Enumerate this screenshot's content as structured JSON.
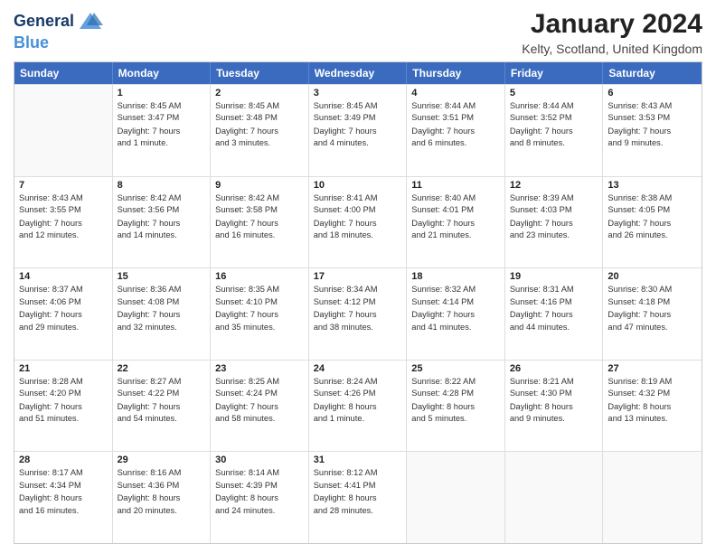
{
  "header": {
    "logo_line1": "General",
    "logo_line2": "Blue",
    "title": "January 2024",
    "subtitle": "Kelty, Scotland, United Kingdom"
  },
  "days_of_week": [
    "Sunday",
    "Monday",
    "Tuesday",
    "Wednesday",
    "Thursday",
    "Friday",
    "Saturday"
  ],
  "weeks": [
    [
      {
        "day": "",
        "sunrise": "",
        "sunset": "",
        "daylight": ""
      },
      {
        "day": "1",
        "sunrise": "Sunrise: 8:45 AM",
        "sunset": "Sunset: 3:47 PM",
        "daylight": "Daylight: 7 hours and 1 minute."
      },
      {
        "day": "2",
        "sunrise": "Sunrise: 8:45 AM",
        "sunset": "Sunset: 3:48 PM",
        "daylight": "Daylight: 7 hours and 3 minutes."
      },
      {
        "day": "3",
        "sunrise": "Sunrise: 8:45 AM",
        "sunset": "Sunset: 3:49 PM",
        "daylight": "Daylight: 7 hours and 4 minutes."
      },
      {
        "day": "4",
        "sunrise": "Sunrise: 8:44 AM",
        "sunset": "Sunset: 3:51 PM",
        "daylight": "Daylight: 7 hours and 6 minutes."
      },
      {
        "day": "5",
        "sunrise": "Sunrise: 8:44 AM",
        "sunset": "Sunset: 3:52 PM",
        "daylight": "Daylight: 7 hours and 8 minutes."
      },
      {
        "day": "6",
        "sunrise": "Sunrise: 8:43 AM",
        "sunset": "Sunset: 3:53 PM",
        "daylight": "Daylight: 7 hours and 9 minutes."
      }
    ],
    [
      {
        "day": "7",
        "sunrise": "Sunrise: 8:43 AM",
        "sunset": "Sunset: 3:55 PM",
        "daylight": "Daylight: 7 hours and 12 minutes."
      },
      {
        "day": "8",
        "sunrise": "Sunrise: 8:42 AM",
        "sunset": "Sunset: 3:56 PM",
        "daylight": "Daylight: 7 hours and 14 minutes."
      },
      {
        "day": "9",
        "sunrise": "Sunrise: 8:42 AM",
        "sunset": "Sunset: 3:58 PM",
        "daylight": "Daylight: 7 hours and 16 minutes."
      },
      {
        "day": "10",
        "sunrise": "Sunrise: 8:41 AM",
        "sunset": "Sunset: 4:00 PM",
        "daylight": "Daylight: 7 hours and 18 minutes."
      },
      {
        "day": "11",
        "sunrise": "Sunrise: 8:40 AM",
        "sunset": "Sunset: 4:01 PM",
        "daylight": "Daylight: 7 hours and 21 minutes."
      },
      {
        "day": "12",
        "sunrise": "Sunrise: 8:39 AM",
        "sunset": "Sunset: 4:03 PM",
        "daylight": "Daylight: 7 hours and 23 minutes."
      },
      {
        "day": "13",
        "sunrise": "Sunrise: 8:38 AM",
        "sunset": "Sunset: 4:05 PM",
        "daylight": "Daylight: 7 hours and 26 minutes."
      }
    ],
    [
      {
        "day": "14",
        "sunrise": "Sunrise: 8:37 AM",
        "sunset": "Sunset: 4:06 PM",
        "daylight": "Daylight: 7 hours and 29 minutes."
      },
      {
        "day": "15",
        "sunrise": "Sunrise: 8:36 AM",
        "sunset": "Sunset: 4:08 PM",
        "daylight": "Daylight: 7 hours and 32 minutes."
      },
      {
        "day": "16",
        "sunrise": "Sunrise: 8:35 AM",
        "sunset": "Sunset: 4:10 PM",
        "daylight": "Daylight: 7 hours and 35 minutes."
      },
      {
        "day": "17",
        "sunrise": "Sunrise: 8:34 AM",
        "sunset": "Sunset: 4:12 PM",
        "daylight": "Daylight: 7 hours and 38 minutes."
      },
      {
        "day": "18",
        "sunrise": "Sunrise: 8:32 AM",
        "sunset": "Sunset: 4:14 PM",
        "daylight": "Daylight: 7 hours and 41 minutes."
      },
      {
        "day": "19",
        "sunrise": "Sunrise: 8:31 AM",
        "sunset": "Sunset: 4:16 PM",
        "daylight": "Daylight: 7 hours and 44 minutes."
      },
      {
        "day": "20",
        "sunrise": "Sunrise: 8:30 AM",
        "sunset": "Sunset: 4:18 PM",
        "daylight": "Daylight: 7 hours and 47 minutes."
      }
    ],
    [
      {
        "day": "21",
        "sunrise": "Sunrise: 8:28 AM",
        "sunset": "Sunset: 4:20 PM",
        "daylight": "Daylight: 7 hours and 51 minutes."
      },
      {
        "day": "22",
        "sunrise": "Sunrise: 8:27 AM",
        "sunset": "Sunset: 4:22 PM",
        "daylight": "Daylight: 7 hours and 54 minutes."
      },
      {
        "day": "23",
        "sunrise": "Sunrise: 8:25 AM",
        "sunset": "Sunset: 4:24 PM",
        "daylight": "Daylight: 7 hours and 58 minutes."
      },
      {
        "day": "24",
        "sunrise": "Sunrise: 8:24 AM",
        "sunset": "Sunset: 4:26 PM",
        "daylight": "Daylight: 8 hours and 1 minute."
      },
      {
        "day": "25",
        "sunrise": "Sunrise: 8:22 AM",
        "sunset": "Sunset: 4:28 PM",
        "daylight": "Daylight: 8 hours and 5 minutes."
      },
      {
        "day": "26",
        "sunrise": "Sunrise: 8:21 AM",
        "sunset": "Sunset: 4:30 PM",
        "daylight": "Daylight: 8 hours and 9 minutes."
      },
      {
        "day": "27",
        "sunrise": "Sunrise: 8:19 AM",
        "sunset": "Sunset: 4:32 PM",
        "daylight": "Daylight: 8 hours and 13 minutes."
      }
    ],
    [
      {
        "day": "28",
        "sunrise": "Sunrise: 8:17 AM",
        "sunset": "Sunset: 4:34 PM",
        "daylight": "Daylight: 8 hours and 16 minutes."
      },
      {
        "day": "29",
        "sunrise": "Sunrise: 8:16 AM",
        "sunset": "Sunset: 4:36 PM",
        "daylight": "Daylight: 8 hours and 20 minutes."
      },
      {
        "day": "30",
        "sunrise": "Sunrise: 8:14 AM",
        "sunset": "Sunset: 4:39 PM",
        "daylight": "Daylight: 8 hours and 24 minutes."
      },
      {
        "day": "31",
        "sunrise": "Sunrise: 8:12 AM",
        "sunset": "Sunset: 4:41 PM",
        "daylight": "Daylight: 8 hours and 28 minutes."
      },
      {
        "day": "",
        "sunrise": "",
        "sunset": "",
        "daylight": ""
      },
      {
        "day": "",
        "sunrise": "",
        "sunset": "",
        "daylight": ""
      },
      {
        "day": "",
        "sunrise": "",
        "sunset": "",
        "daylight": ""
      }
    ]
  ]
}
